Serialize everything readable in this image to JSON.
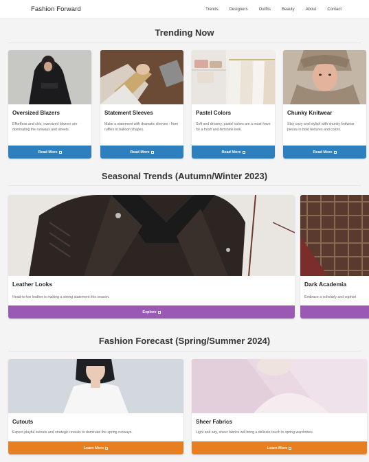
{
  "brand": "Fashion Forward",
  "nav": [
    "Trends",
    "Designers",
    "Outfits",
    "Beauty",
    "About",
    "Contact"
  ],
  "trending": {
    "title": "Trending Now",
    "button_color": "#2e7fbd",
    "cards": [
      {
        "title": "Oversized Blazers",
        "desc": "Effortless and chic, oversized blazers are dominating the runways and streets.",
        "button": "Read More"
      },
      {
        "title": "Statement Sleeves",
        "desc": "Make a statement with dramatic sleeves - from ruffles to balloon shapes.",
        "button": "Read More"
      },
      {
        "title": "Pastel Colors",
        "desc": "Soft and dreamy, pastel colors are a must-have for a fresh and feminine look.",
        "button": "Read More"
      },
      {
        "title": "Chunky Knitwear",
        "desc": "Stay cozy and stylish with chunky knitwear pieces in bold textures and colors.",
        "button": "Read More"
      }
    ]
  },
  "seasonal": {
    "title": "Seasonal Trends (Autumn/Winter 2023)",
    "button_color": "#9b59b6",
    "cards": [
      {
        "title": "Leather Looks",
        "desc": "Head-to-toe leather is making a strong statement this season.",
        "button": "Explore"
      },
      {
        "title": "Dark Academia",
        "desc": "Embrace a scholarly and sophist",
        "button": ""
      }
    ]
  },
  "forecast": {
    "title": "Fashion Forecast (Spring/Summer 2024)",
    "button_color": "#e67e22",
    "cards": [
      {
        "title": "Cutouts",
        "desc": "Expect playful cutouts and strategic reveals to dominate the spring runways.",
        "button": "Learn More"
      },
      {
        "title": "Sheer Fabrics",
        "desc": "Light and airy, sheer fabrics will bring a delicate touch to spring wardrobes.",
        "button": "Learn More"
      }
    ]
  }
}
